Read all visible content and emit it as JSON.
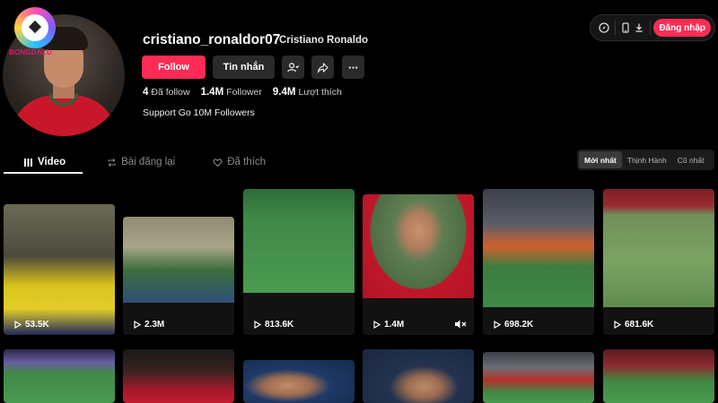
{
  "header": {
    "login_label": "Đăng nhập"
  },
  "branding": {
    "watermark": "BONGDALU"
  },
  "profile": {
    "username": "cristiano_ronaldor07",
    "nickname": "Cristiano Ronaldo",
    "follow_label": "Follow",
    "message_label": "Tin nhắn",
    "stats": [
      {
        "num": "4",
        "label": "Đã follow"
      },
      {
        "num": "1.4M",
        "label": "Follower"
      },
      {
        "num": "9.4M",
        "label": "Lượt thích"
      }
    ],
    "bio": "Support Go 10M Followers"
  },
  "tabs": [
    {
      "label": "Video",
      "icon": "grid-icon",
      "active": true
    },
    {
      "label": "Bài đăng lại",
      "icon": "repost-icon",
      "active": false
    },
    {
      "label": "Đã thích",
      "icon": "heart-icon",
      "active": false
    }
  ],
  "sort_options": [
    {
      "label": "Mới nhất",
      "active": true
    },
    {
      "label": "Thịnh Hành",
      "active": false
    },
    {
      "label": "Cũ nhất",
      "active": false
    }
  ],
  "videos": [
    {
      "views": "53.5K"
    },
    {
      "views": "2.3M"
    },
    {
      "views": "813.6K"
    },
    {
      "views": "1.4M",
      "muted": true
    },
    {
      "views": "698.2K"
    },
    {
      "views": "681.6K"
    }
  ],
  "colors": {
    "accent": "#fe2c55",
    "background": "#000000"
  }
}
